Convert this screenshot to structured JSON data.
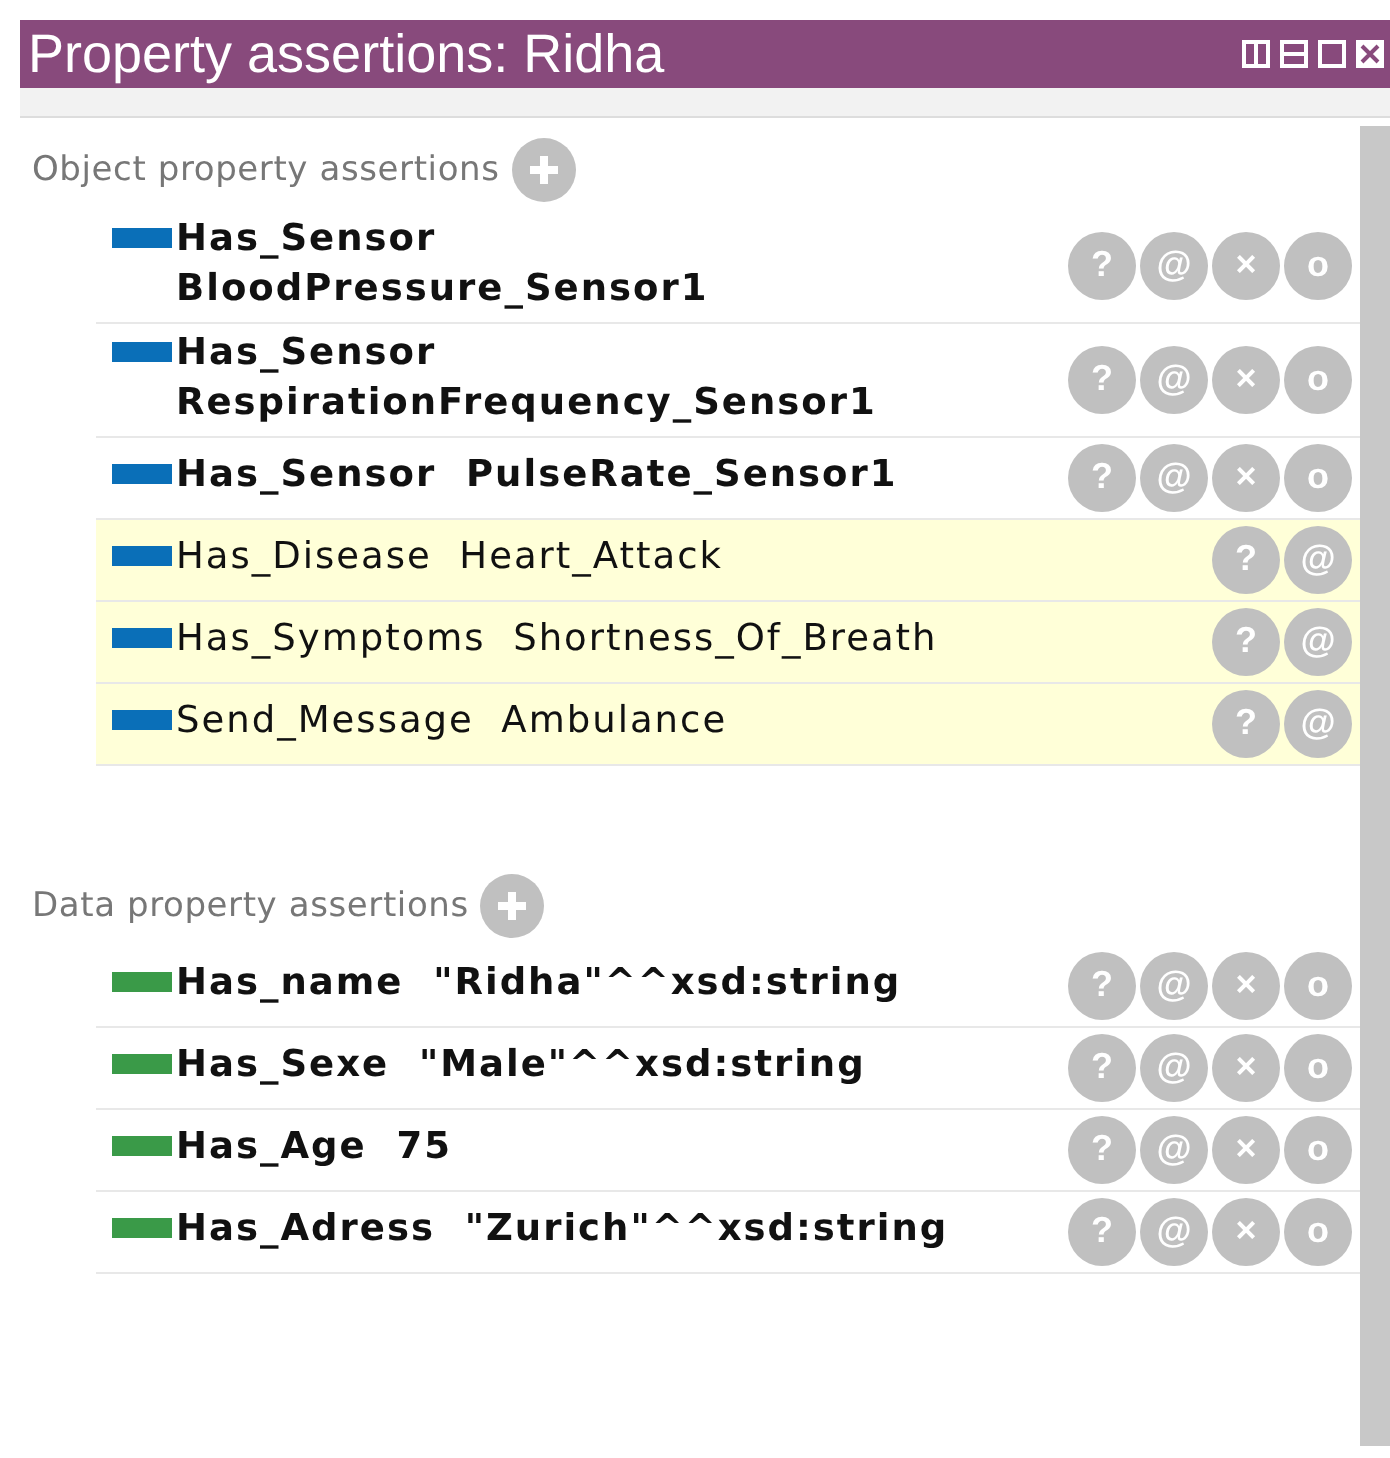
{
  "window": {
    "title": "Property assertions: Ridha"
  },
  "sections": [
    {
      "title": "Object property assertions",
      "kind": "object",
      "items": [
        {
          "text": "Has_Sensor  BloodPressure_Sensor1",
          "inferred": false,
          "buttons": [
            "?",
            "@",
            "×",
            "o"
          ]
        },
        {
          "text": "Has_Sensor  RespirationFrequency_Sensor1",
          "inferred": false,
          "buttons": [
            "?",
            "@",
            "×",
            "o"
          ]
        },
        {
          "text": "Has_Sensor  PulseRate_Sensor1",
          "inferred": false,
          "buttons": [
            "?",
            "@",
            "×",
            "o"
          ]
        },
        {
          "text": "Has_Disease  Heart_Attack",
          "inferred": true,
          "buttons": [
            "?",
            "@"
          ]
        },
        {
          "text": "Has_Symptoms  Shortness_Of_Breath",
          "inferred": true,
          "buttons": [
            "?",
            "@"
          ]
        },
        {
          "text": "Send_Message  Ambulance",
          "inferred": true,
          "buttons": [
            "?",
            "@"
          ]
        }
      ]
    },
    {
      "title": "Data property assertions",
      "kind": "data",
      "items": [
        {
          "text": "Has_name  \"Ridha\"^^xsd:string",
          "inferred": false,
          "buttons": [
            "?",
            "@",
            "×",
            "o"
          ]
        },
        {
          "text": "Has_Sexe  \"Male\"^^xsd:string",
          "inferred": false,
          "buttons": [
            "?",
            "@",
            "×",
            "o"
          ]
        },
        {
          "text": "Has_Age  75",
          "inferred": false,
          "buttons": [
            "?",
            "@",
            "×",
            "o"
          ]
        },
        {
          "text": "Has_Adress  \"Zurich\"^^xsd:string",
          "inferred": false,
          "buttons": [
            "?",
            "@",
            "×",
            "o"
          ]
        }
      ]
    }
  ]
}
